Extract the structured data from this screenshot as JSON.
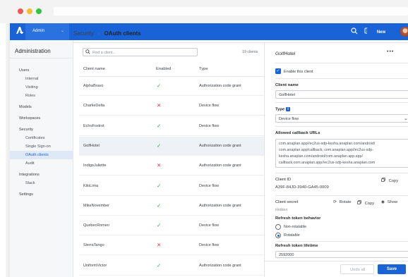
{
  "header": {
    "workspace": "Admin"
  },
  "nav": {
    "title": "Administration",
    "items": [
      {
        "label": "Users",
        "level": "top"
      },
      {
        "label": "Internal",
        "level": "sub"
      },
      {
        "label": "Visiting",
        "level": "sub"
      },
      {
        "label": "Roles",
        "level": "sub"
      },
      {
        "label": "Models",
        "level": "top"
      },
      {
        "label": "Workspaces",
        "level": "top"
      },
      {
        "label": "Security",
        "level": "top"
      },
      {
        "label": "Certificates",
        "level": "sub"
      },
      {
        "label": "Single Sign-on",
        "level": "sub"
      },
      {
        "label": "OAuth clients",
        "level": "sub",
        "active": true
      },
      {
        "label": "Audit",
        "level": "sub"
      },
      {
        "label": "Integrations",
        "level": "top"
      },
      {
        "label": "Slack",
        "level": "sub"
      },
      {
        "label": "Settings",
        "level": "top"
      }
    ]
  },
  "breadcrumb": {
    "parent": "Security",
    "current": "OAuth clients"
  },
  "new_button": "New",
  "search": {
    "placeholder": "Find a client...",
    "count": "19 clients"
  },
  "table": {
    "columns": [
      "Client name",
      "Enabled",
      "Type"
    ],
    "rows": [
      {
        "name": "AlphaBravo",
        "enabled": true,
        "type": "Authorization code grant"
      },
      {
        "name": "CharlieDelta",
        "enabled": false,
        "type": "Device flow"
      },
      {
        "name": "EchoFoxtrot",
        "enabled": true,
        "type": "Device flow"
      },
      {
        "name": "GolfHotel",
        "enabled": true,
        "type": "Authorization code grant",
        "selected": true
      },
      {
        "name": "IndigoJuliette",
        "enabled": false,
        "type": "Authorization code grant"
      },
      {
        "name": "KiloLima",
        "enabled": true,
        "type": "Device flow"
      },
      {
        "name": "MikeNovember",
        "enabled": true,
        "type": "Authorization code grant"
      },
      {
        "name": "QuebecRomeo",
        "enabled": true,
        "type": "Device flow"
      },
      {
        "name": "SierraTango",
        "enabled": false,
        "type": "Device flow"
      },
      {
        "name": "UniformVictor",
        "enabled": true,
        "type": "Authorization code grant"
      }
    ]
  },
  "detail": {
    "title": "GolfHotel",
    "enable_label": "Enable this client",
    "client_name_label": "Client name",
    "client_name_value": "GolfHotel",
    "type_label": "Type",
    "type_value": "Device flow",
    "callbacks_label": "Allowed callback URLs",
    "callback_lines": [
      "com.anaplan.app//ec2us-sdp-kesha.anaplan.com/android/",
      "com.anaplan.app/callback, com.anaplan.app//ec2us-sdp-",
      "kesha.anaplan.com/android/com.anaplan.app.app/",
      "callback,com.anaplan.app//ec2us-sdp-kesha.anaplan.com"
    ],
    "client_id_label": "Client ID",
    "client_id_value": "A39F-84JD-3940-GA45-0009",
    "copy_label": "Copy",
    "secret_label": "Client secret",
    "secret_value": "Hidden",
    "rotate_label": "Rotate",
    "show_label": "Show",
    "refresh_label": "Refresh token behavior",
    "refresh_options": [
      "Non-rotatable",
      "Rotatable"
    ],
    "refresh_selected": "Rotatable",
    "lifetime_label": "Refresh token lifetime",
    "lifetime_value": "2592000"
  },
  "footer": {
    "undo": "Undo all",
    "save": "Save"
  },
  "colors": {
    "brand": "#1a63d6",
    "success": "#2ba84a",
    "danger": "#e03b3b"
  }
}
